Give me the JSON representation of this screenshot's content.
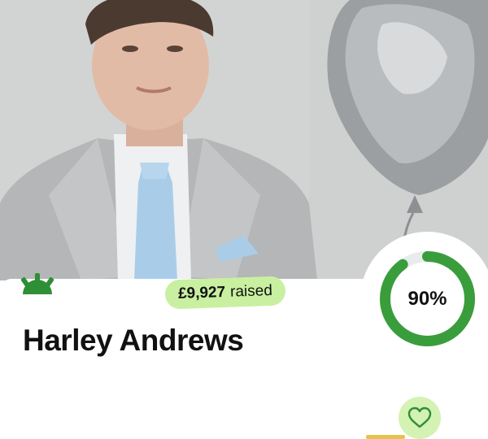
{
  "fundraiser": {
    "name": "Harley Andrews",
    "amount_raised": "£9,927",
    "raised_label": "raised",
    "progress_percent_text": "90%",
    "progress_fraction": 0.9
  },
  "icons": {
    "logo": "charity-logo-icon",
    "favourite": "heart-icon"
  },
  "colors": {
    "accent_green": "#3a9d3c",
    "pill_green": "#c8f0a0",
    "heart_bg": "#d4f2b4"
  }
}
